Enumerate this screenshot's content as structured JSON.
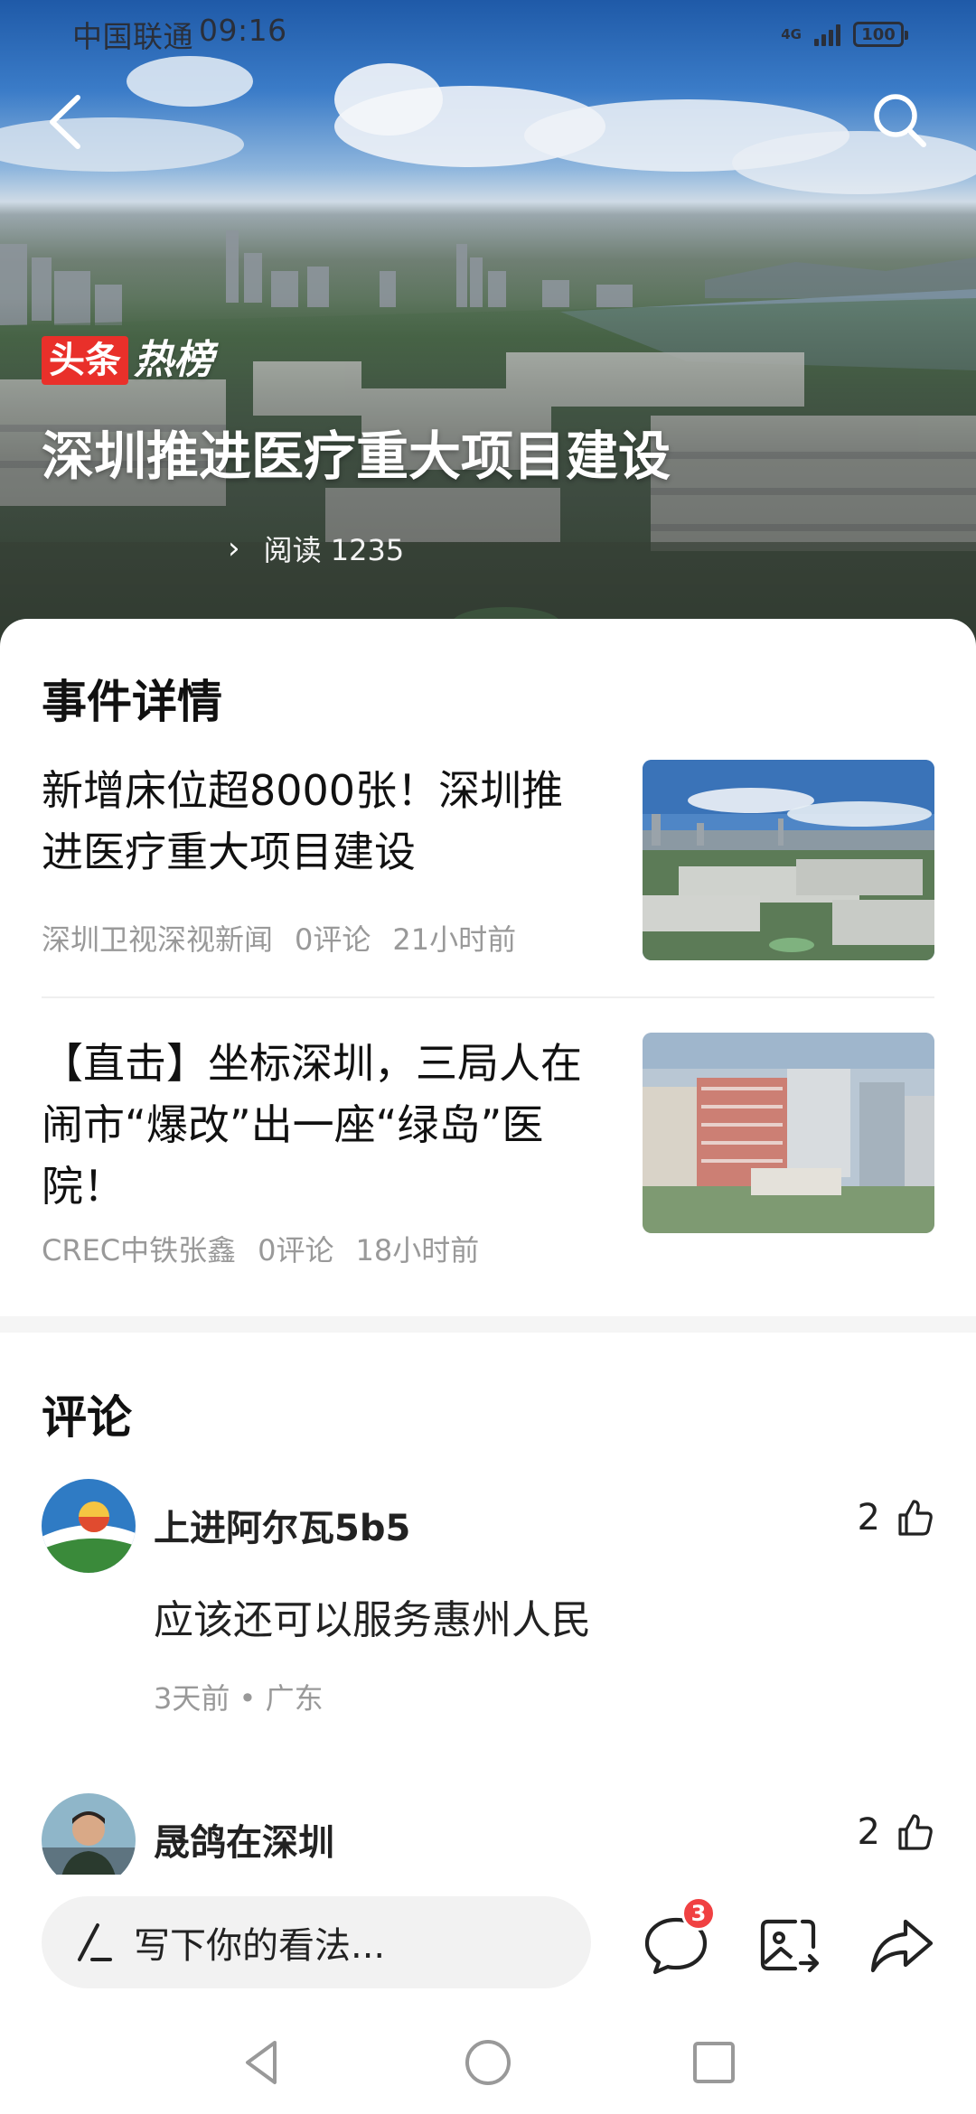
{
  "status_bar": {
    "carrier": "中国联通",
    "time": "09:16",
    "network": "4G",
    "battery": "100"
  },
  "hero": {
    "badge_box": "头条",
    "badge_word": "热榜",
    "title": "深圳推进医疗重大项目建设",
    "reads_label": "阅读",
    "reads_count": "1235"
  },
  "event_section": {
    "title": "事件详情",
    "articles": [
      {
        "title": "新增床位超8000张！深圳推进医疗重大项目建设",
        "source": "深圳卫视深视新闻",
        "comments": "0评论",
        "time": "21小时前"
      },
      {
        "title": "【直击】坐标深圳，三局人在闹市“爆改”出一座“绿岛”医院！",
        "source": "CREC中铁张鑫",
        "comments": "0评论",
        "time": "18小时前"
      }
    ]
  },
  "comments_section": {
    "title": "评论",
    "comments": [
      {
        "name": "上进阿尔瓦5b5",
        "likes": "2",
        "text": "应该还可以服务惠州人民",
        "meta": "3天前 • 广东"
      },
      {
        "name": "晟鸽在深圳",
        "likes": "2"
      }
    ]
  },
  "bottom_bar": {
    "placeholder": "写下你的看法...",
    "comment_badge": "3"
  },
  "colors": {
    "accent_red": "#e9302a",
    "badge_red": "#f04142",
    "meta_gray": "#999999"
  },
  "icons": [
    "back-arrow-icon",
    "search-icon",
    "chevron-right-icon",
    "thumb-up-icon",
    "pen-icon",
    "comment-bubble-icon",
    "image-share-icon",
    "share-arrow-icon",
    "nav-back-icon",
    "nav-home-icon",
    "nav-recent-icon"
  ]
}
